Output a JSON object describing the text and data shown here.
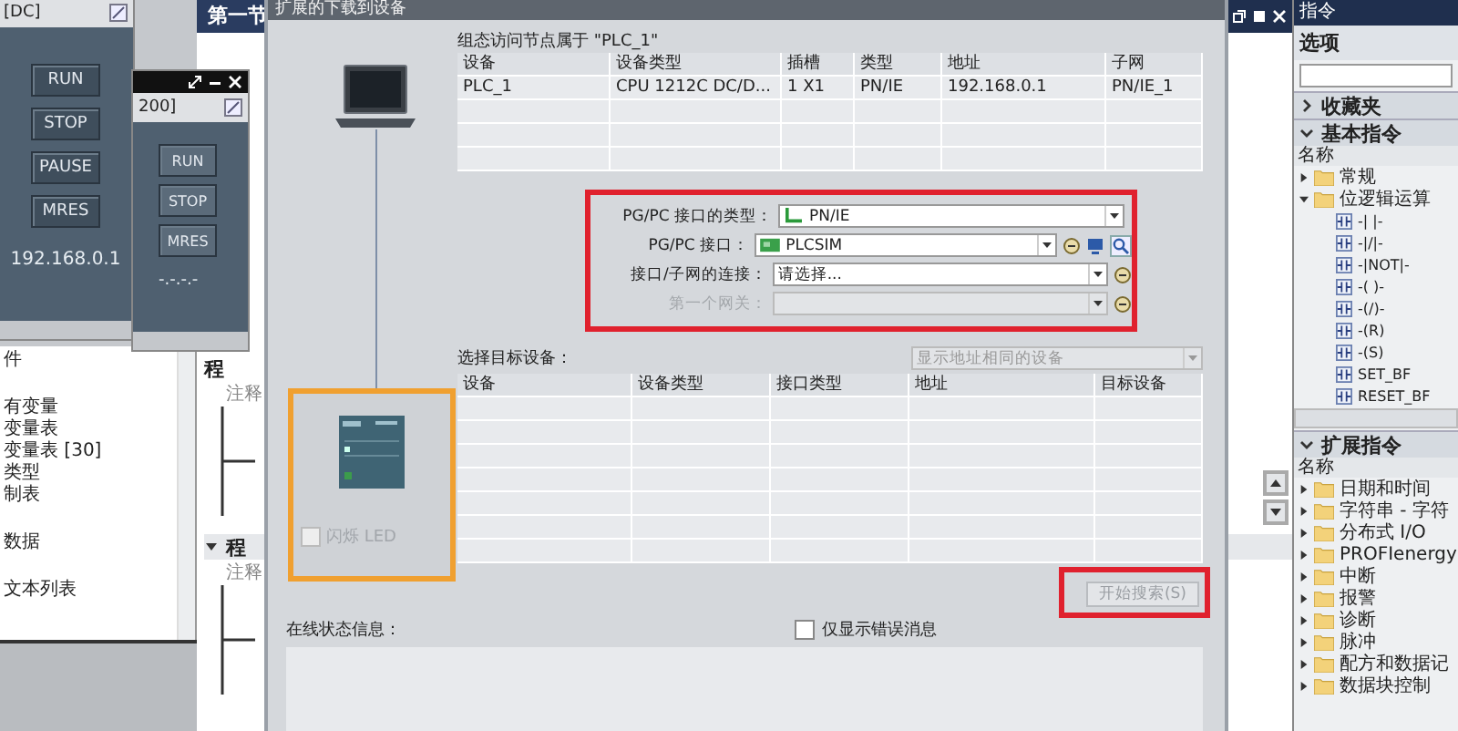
{
  "sim_windows": [
    {
      "title": "[DC]",
      "buttons": [
        "RUN",
        "STOP",
        "PAUSE",
        "MRES"
      ],
      "address": "192.168.0.1"
    },
    {
      "title": "200]",
      "buttons": [
        "RUN",
        "STOP",
        "MRES"
      ],
      "address": "-.-.-.-"
    }
  ],
  "project_tree": {
    "items": [
      "件",
      "有变量",
      "变量表",
      "变量表 [30]",
      "类型",
      "制表",
      "数据",
      "文本列表"
    ]
  },
  "editor": {
    "tab": "第一节",
    "sections": [
      {
        "title": "程",
        "comment": "注释",
        "expanded": false
      },
      {
        "title": "程",
        "comment": "注释",
        "expanded": true
      }
    ]
  },
  "dialog": {
    "title": "扩展的下载到设备",
    "config_caption": "组态访问节点属于 \"PLC_1\"",
    "config_table": {
      "columns": [
        "设备",
        "设备类型",
        "插槽",
        "类型",
        "地址",
        "子网"
      ],
      "rows": [
        [
          "PLC_1",
          "CPU 1212C DC/D...",
          "1 X1",
          "PN/IE",
          "192.168.0.1",
          "PN/IE_1"
        ]
      ]
    },
    "interface_fields": [
      {
        "label": "PG/PC 接口的类型：",
        "value": "PN/IE",
        "kind": "network",
        "disabled": false
      },
      {
        "label": "PG/PC 接口：",
        "value": "PLCSIM",
        "kind": "card",
        "disabled": false
      },
      {
        "label": "接口/子网的连接：",
        "value": "请选择...",
        "kind": "plain",
        "disabled": false
      },
      {
        "label": "第一个网关：",
        "kind": "plain",
        "disabled": true
      }
    ],
    "target_caption": "选择目标设备：",
    "target_filter": "显示地址相同的设备",
    "target_table": {
      "columns": [
        "设备",
        "设备类型",
        "接口类型",
        "地址",
        "目标设备"
      ]
    },
    "flash_led": {
      "label": "闪烁 LED",
      "checked": false
    },
    "search_button": {
      "label": "开始搜索(S)",
      "disabled": true
    },
    "online_caption": "在线状态信息：",
    "errors_only": {
      "label": "仅显示错误消息",
      "checked": false
    }
  },
  "instructions": {
    "title": "指令",
    "options": "选项",
    "favorites": {
      "title": "收藏夹",
      "expanded": false
    },
    "basic": {
      "title": "基本指令",
      "expanded": true,
      "column": "名称",
      "items": [
        {
          "label": "常规",
          "expanded": false
        },
        {
          "label": "位逻辑运算",
          "expanded": true,
          "children": [
            "-| |-",
            "-|/|-",
            "-|NOT|-",
            "-( )-",
            "-(/)-",
            "-(R)",
            "-(S)",
            "SET_BF",
            "RESET_BF"
          ]
        }
      ]
    },
    "extended": {
      "title": "扩展指令",
      "expanded": true,
      "column": "名称",
      "items": [
        {
          "label": "日期和时间",
          "expanded": false
        },
        {
          "label": "字符串 - 字符",
          "expanded": false
        },
        {
          "label": "分布式 I/O",
          "expanded": false
        },
        {
          "label": "PROFIenergy",
          "expanded": false
        },
        {
          "label": "中断",
          "expanded": false
        },
        {
          "label": "报警",
          "expanded": false
        },
        {
          "label": "诊断",
          "expanded": false
        },
        {
          "label": "脉冲",
          "expanded": false
        },
        {
          "label": "配方和数据记",
          "expanded": false
        },
        {
          "label": "数据块控制",
          "expanded": false
        }
      ]
    }
  }
}
